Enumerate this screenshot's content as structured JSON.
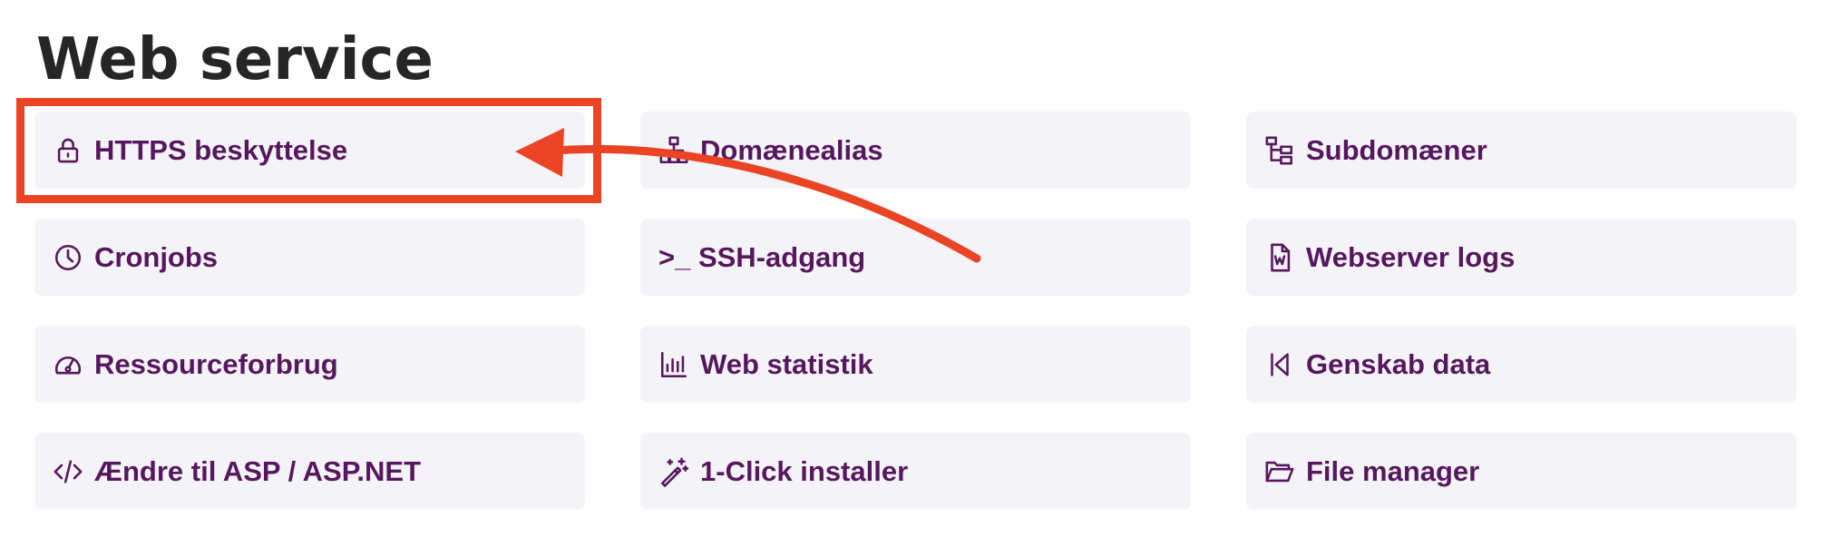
{
  "page": {
    "title": "Web service"
  },
  "tiles": [
    {
      "label": "HTTPS beskyttelse",
      "icon": "lock-icon"
    },
    {
      "label": "Domænealias",
      "icon": "sitemap-icon"
    },
    {
      "label": "Subdomæner",
      "icon": "subdomains-icon"
    },
    {
      "label": "Cronjobs",
      "icon": "clock-icon"
    },
    {
      "label": ">_ SSH-adgang",
      "icon": "terminal-icon"
    },
    {
      "label": "Webserver logs",
      "icon": "log-file-icon"
    },
    {
      "label": "Ressourceforbrug",
      "icon": "gauge-icon"
    },
    {
      "label": "Web statistik",
      "icon": "bar-chart-icon"
    },
    {
      "label": "Genskab data",
      "icon": "restore-icon"
    },
    {
      "label": "Ændre til ASP / ASP.NET",
      "icon": "code-icon"
    },
    {
      "label": "1-Click installer",
      "icon": "magic-wand-icon"
    },
    {
      "label": "File manager",
      "icon": "folder-open-icon"
    }
  ],
  "annotation": {
    "color": "#ea4424"
  }
}
